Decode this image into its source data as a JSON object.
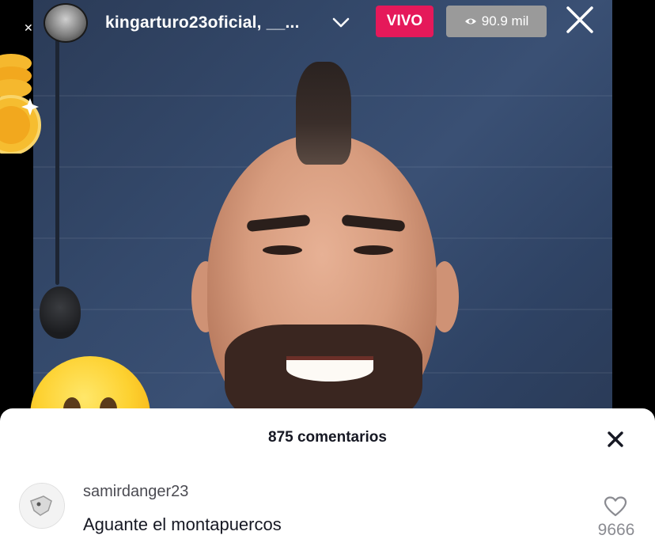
{
  "live_header": {
    "host_name": "kingarturo23oficial, __...",
    "live_badge": "VIVO",
    "viewer_count": "90.9 mil"
  },
  "comments_panel": {
    "count_label": "875 comentarios",
    "comments": [
      {
        "username": "samirdanger23",
        "text": "Aguante el montapuercos",
        "likes": "9666"
      }
    ]
  },
  "colors": {
    "live_badge": "#e5195a",
    "viewer_pill": "#9a9a9a",
    "sheet_background": "#ffffff",
    "video_background": "#34496b"
  }
}
